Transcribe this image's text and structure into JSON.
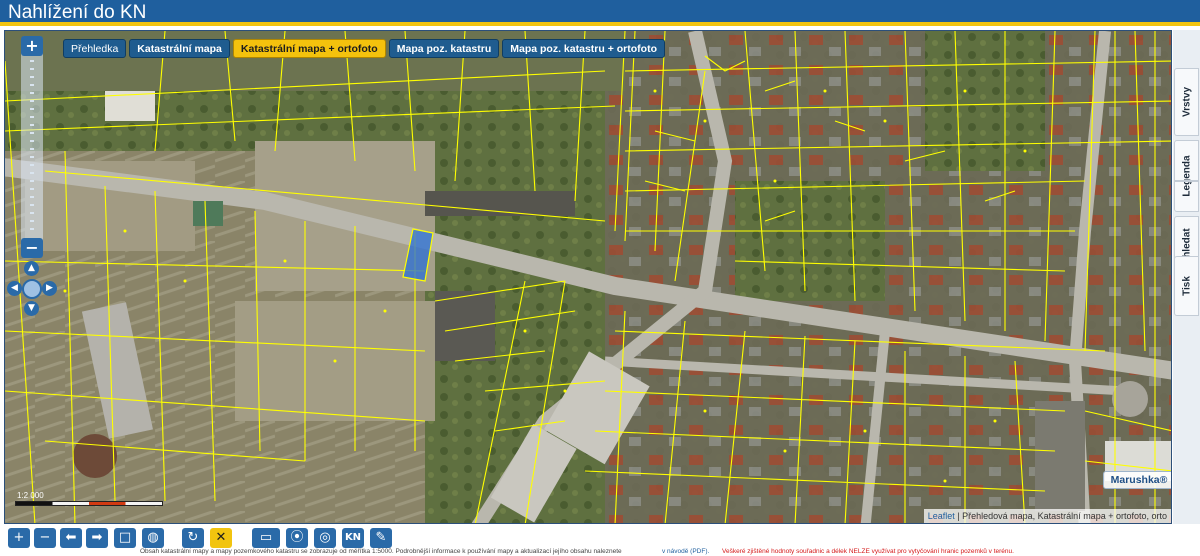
{
  "app": {
    "title": "Nahlížení do KN"
  },
  "layers": {
    "overview": "Přehledka",
    "cadastral": "Katastrální mapa",
    "cadastral_ortho": "Katastrální mapa + ortofoto",
    "land_map": "Mapa poz. katastru",
    "land_map_ortho": "Mapa poz. katastru + ortofoto",
    "active": "Katastrální mapa + ortofoto"
  },
  "zoom": {
    "in": "+",
    "out": "−"
  },
  "scale": {
    "label": "1:2 000"
  },
  "attribution": {
    "link": "Leaflet",
    "text": " | Přehledová mapa, Katastrální mapa + ortofoto, orto"
  },
  "side_tabs": [
    "Vrstvy",
    "Legenda",
    "Vyhledat",
    "Tisk"
  ],
  "brand": "Marushka®",
  "toolbar": {
    "icons": [
      "zoom-in-icon",
      "zoom-out-icon",
      "back-icon",
      "forward-icon",
      "select-area-icon",
      "globe-icon",
      "refresh-icon",
      "clear-icon",
      "measure-icon",
      "position-icon",
      "kn-icon",
      "comment-icon"
    ],
    "kn_label": "KN"
  },
  "footer": {
    "part1": "Obsah katastrální mapy a mapy pozemkového katastru se zobrazuje od měřítka 1:5000. Podrobnější informace k používání mapy a aktualizací jejího obsahu naleznete",
    "part2": "v návodě (PDF).",
    "part3": "Veškeré zjištěné hodnoty souřadnic a délek NELZE využívat pro vytyčování hranic pozemků v terénu."
  },
  "colors": {
    "header": "#1f5f9e",
    "accent": "#f2c40f",
    "parcel_lines": "#ffff00",
    "selection": "#2a6fd6"
  }
}
